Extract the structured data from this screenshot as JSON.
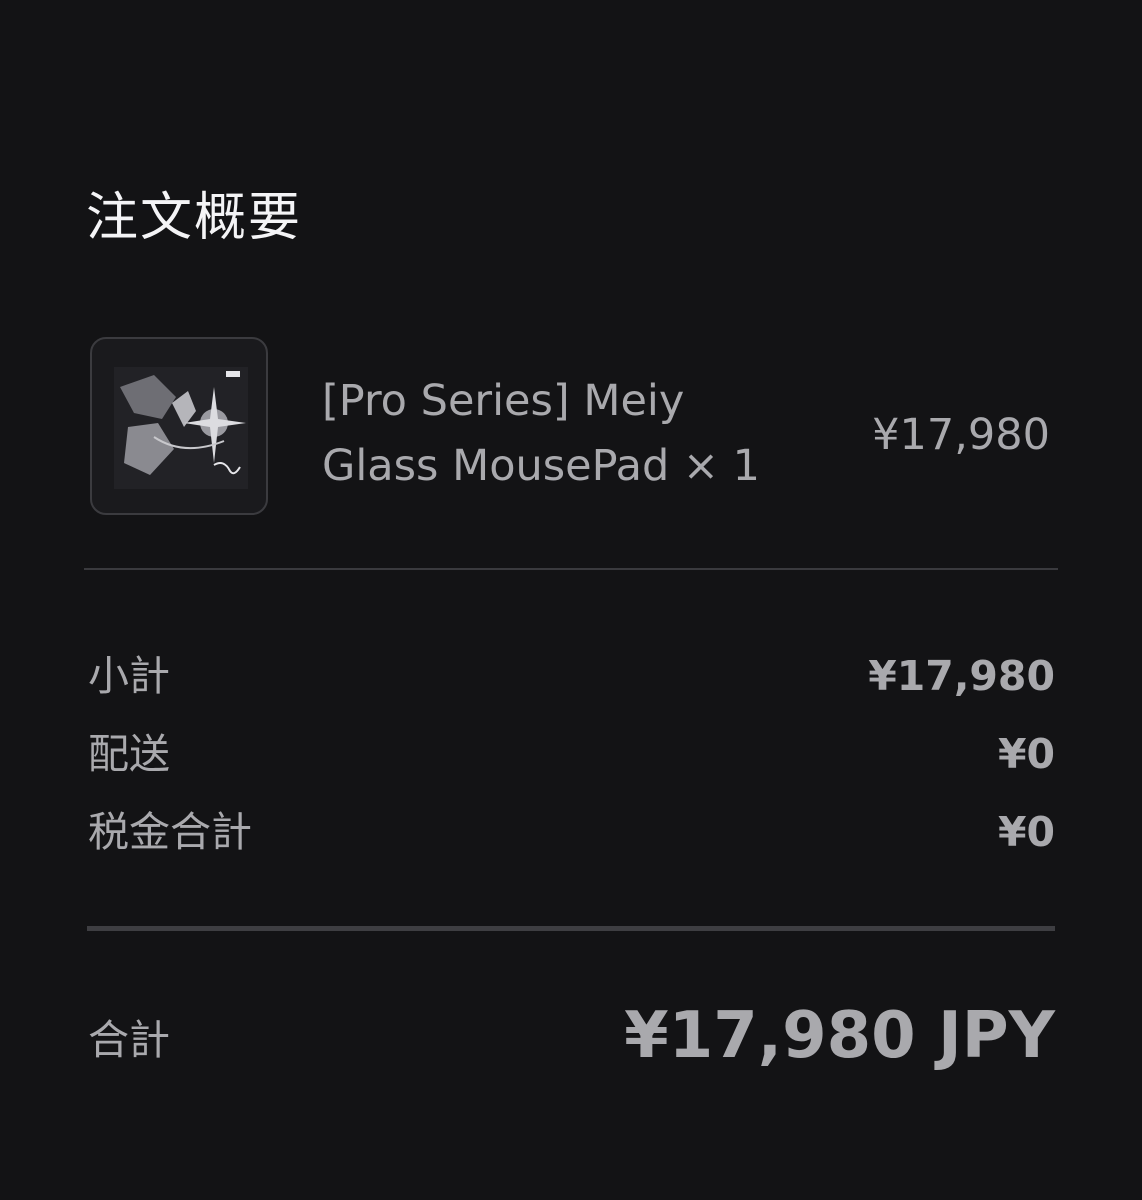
{
  "summary": {
    "title": "注文概要"
  },
  "line_item": {
    "thumbnail_icon": "mousepad-product-image",
    "name_line1": "[Pro Series] Meiy",
    "name_line2": "Glass MousePad × 1",
    "price": "¥17,980"
  },
  "costs": {
    "subtotal_label": "小計",
    "subtotal_value": "¥17,980",
    "shipping_label": "配送",
    "shipping_value": "¥0",
    "tax_label": "税金合計",
    "tax_value": "¥0"
  },
  "total": {
    "label": "合計",
    "value": "¥17,980 JPY"
  },
  "colors": {
    "background": "#131315",
    "title_text": "#f4f4f6",
    "secondary_text": "#a9a9ad",
    "divider": "#3a3a3e"
  }
}
